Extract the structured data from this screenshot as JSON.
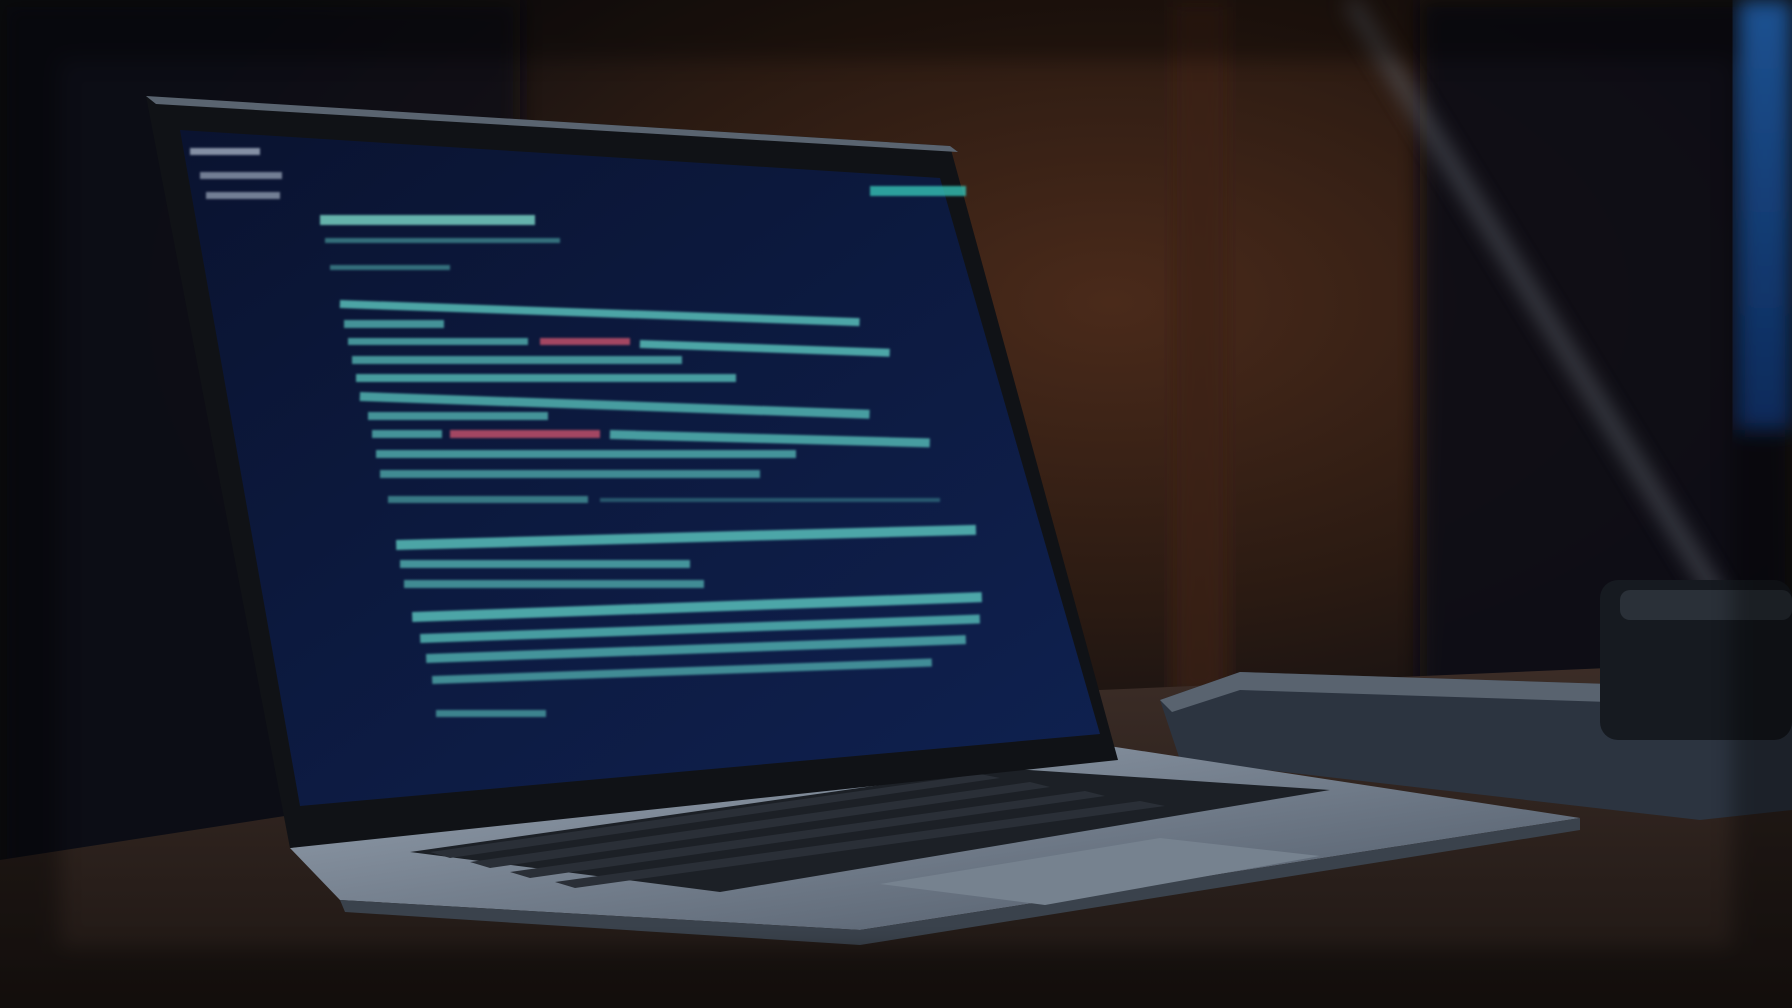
{
  "scene": {
    "description_tag": "laptop-on-desk-dark-room",
    "colors": {
      "background_dark": "#0b0d12",
      "wall_warm": "#2a1a12",
      "wall_highlight": "#4a2a1a",
      "desk": "#2b201c",
      "desk_edge": "#3c2d27",
      "laptop_body": "#8a97a6",
      "laptop_body_dark": "#4b5563",
      "screen_bezel": "#111319",
      "screen_bg": "#0c1838",
      "code_primary": "#5cc8c0",
      "code_secondary": "#7cd9c9",
      "code_accent": "#c9536a",
      "keyboard": "#1c2026",
      "key": "#2a2f37",
      "monitor_glow": "#1e63c8",
      "device_right": "#2c3440"
    },
    "icons": [
      "laptop-icon",
      "external-device-icon",
      "monitor-icon",
      "desk-lamp-icon"
    ]
  }
}
